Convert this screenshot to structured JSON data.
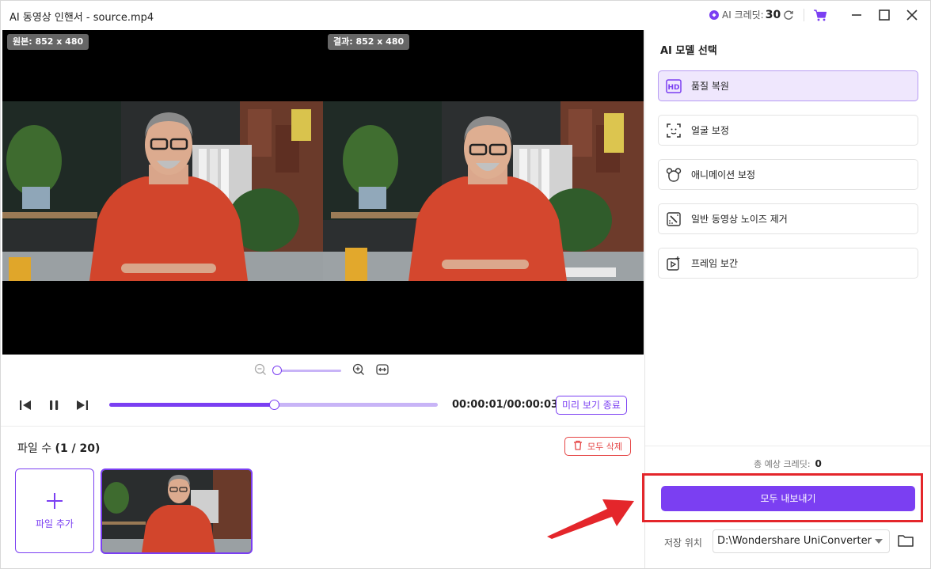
{
  "window": {
    "title": "AI 동영상 인핸서 - source.mp4",
    "credits_label": "AI 크레딧:",
    "credits_value": "30"
  },
  "preview": {
    "original_badge": "원본: 852 x 480",
    "result_badge": "결과: 852 x 480"
  },
  "playback": {
    "timecode": "00:00:01/00:00:03",
    "progress": 0.5,
    "end_preview_label": "미리 보기 종료"
  },
  "files": {
    "count_label": "파일 수",
    "count_value": "(1 / 20)",
    "delete_all_label": "모두 삭제",
    "add_file_label": "파일 추가"
  },
  "panel": {
    "title": "AI 모델 선택",
    "models": [
      {
        "label": "품질 복원",
        "icon": "hd-icon",
        "active": true
      },
      {
        "label": "얼굴 보정",
        "icon": "face-scan-icon",
        "active": false
      },
      {
        "label": "애니메이션 보정",
        "icon": "bear-icon",
        "active": false
      },
      {
        "label": "일반 동영상 노이즈 제거",
        "icon": "denoise-icon",
        "active": false
      },
      {
        "label": "프레임 보간",
        "icon": "frame-interp-icon",
        "active": false
      }
    ],
    "estimate_label": "총 예상 크레딧:",
    "estimate_value": "0",
    "export_all_label": "모두 내보내기",
    "save_location_label": "저장 위치",
    "save_location_value": "D:\\Wondershare UniConverter"
  },
  "colors": {
    "accent": "#7b3ff2",
    "danger": "#e54545",
    "highlight": "#e4262b"
  }
}
